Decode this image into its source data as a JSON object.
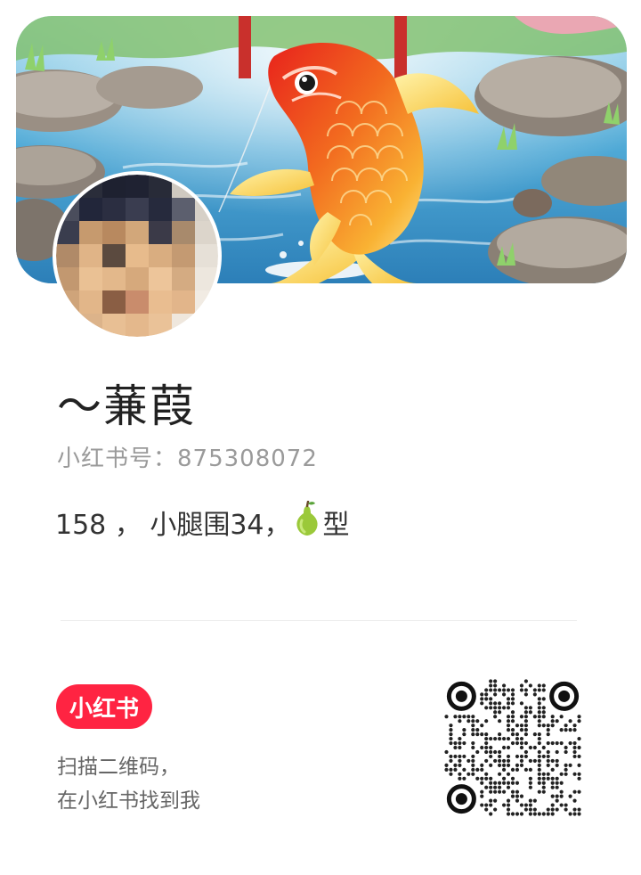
{
  "profile": {
    "nickname": "～蒹葭",
    "red_id_label": "小红书号：",
    "red_id": "875308072",
    "bio_prefix": "158 ，  小腿围34，",
    "bio_suffix": "型",
    "bio_emoji": "pear-icon"
  },
  "footer": {
    "logo_text": "小红书",
    "hint_line1": "扫描二维码，",
    "hint_line2": "在小红书找到我"
  },
  "colors": {
    "brand": "#ff2442",
    "text_primary": "#222222",
    "text_secondary": "#9a9a9a"
  }
}
